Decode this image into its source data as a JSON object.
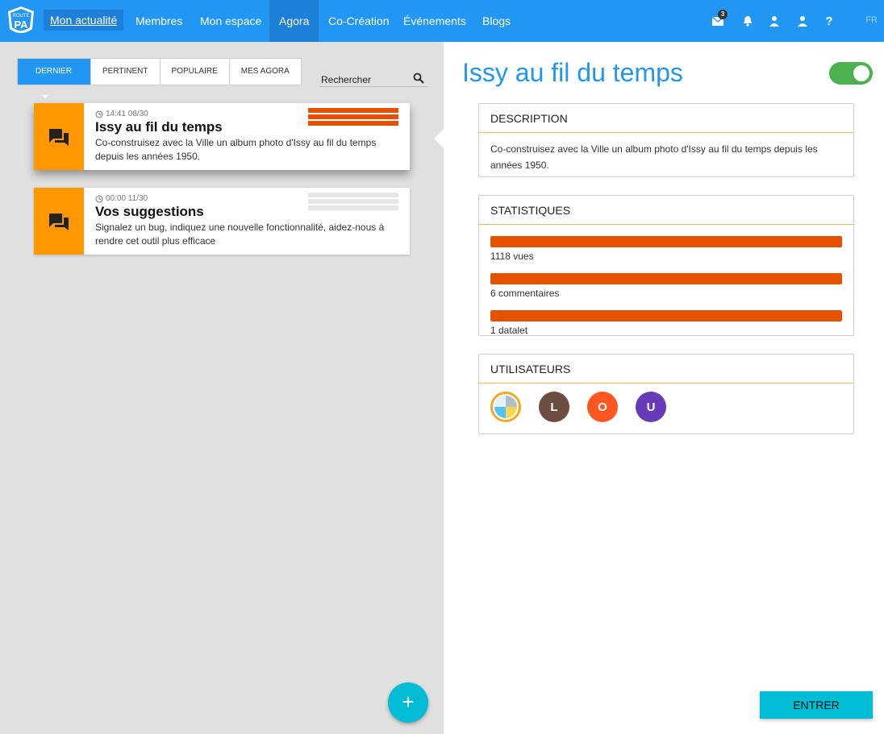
{
  "topbar": {
    "logo_text": "ROUTE PA",
    "nav": [
      "Mon actualité",
      "Membres",
      "Mon espace",
      "Agora",
      "Co-Création",
      "Événements",
      "Blogs"
    ],
    "mail_badge": "3",
    "help": "?",
    "lang": "FR",
    "icons": [
      "mail-icon",
      "bell-icon",
      "user-icon",
      "profile-icon",
      "help-icon"
    ],
    "color": "#2196f3"
  },
  "filters": {
    "tabs": [
      "DERNIER",
      "PERTINENT",
      "POPULAIRE",
      "MES AGORA"
    ],
    "active": "DERNIER",
    "search_label": "Rechercher"
  },
  "cards": [
    {
      "time": "14:41 08/30",
      "title": "Issy au fil du temps",
      "desc": "Co-construisez avec la Ville un album photo d'Issy au fil du temps depuis les années 1950.",
      "selected": true,
      "bar_color": "#e65100"
    },
    {
      "time": "00:00 11/30",
      "title": "Vos suggestions",
      "desc": "Signalez un bug, indiquez une nouvelle fonctionnalité, aidez-nous à rendre cet outil plus efficace",
      "selected": false,
      "bar_color": "#e0e0e0"
    }
  ],
  "detail": {
    "title": "Issy au fil du temps",
    "toggle_on": true,
    "description_head": "DESCRIPTION",
    "description": "Co-construisez avec la Ville un album photo d'Issy au fil du temps depuis les années 1950.",
    "stats_head": "STATISTIQUES",
    "stats": [
      "1118 vues",
      "6 commentaires",
      "1 datalet"
    ],
    "users_head": "UTILISATEURS",
    "users": [
      {
        "letter": "L",
        "color": "#6d4c41"
      },
      {
        "letter": "O",
        "color": "#ff5722"
      },
      {
        "letter": "U",
        "color": "#673ab7"
      }
    ],
    "enter_label": "ENTRER"
  },
  "fab_label": "+"
}
